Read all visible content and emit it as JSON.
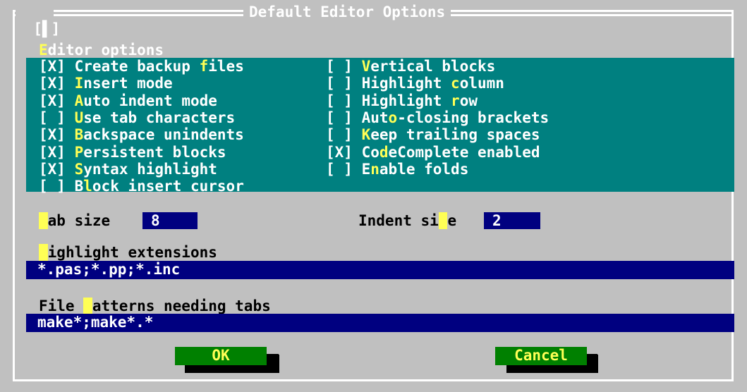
{
  "window": {
    "title": "Default Editor Options",
    "close_mark": "[▌]"
  },
  "editor_options": {
    "label": "Editor options",
    "left": [
      {
        "check": "[X]",
        "label": "Create backup files",
        "hotkey_index": 14
      },
      {
        "check": "[X]",
        "label": "Insert mode",
        "hotkey_index": 0
      },
      {
        "check": "[X]",
        "label": "Auto indent mode",
        "hotkey_index": 0
      },
      {
        "check": "[ ]",
        "label": "Use tab characters",
        "hotkey_index": 0
      },
      {
        "check": "[X]",
        "label": "Backspace unindents",
        "hotkey_index": 0
      },
      {
        "check": "[X]",
        "label": "Persistent blocks",
        "hotkey_index": 0
      },
      {
        "check": "[X]",
        "label": "Syntax highlight",
        "hotkey_index": 0
      },
      {
        "check": "[ ]",
        "label": "Block insert cursor",
        "hotkey_index": 1
      }
    ],
    "right": [
      {
        "check": "[ ]",
        "label": "Vertical blocks",
        "hotkey_index": 0
      },
      {
        "check": "[ ]",
        "label": "Highlight column",
        "hotkey_index": 10
      },
      {
        "check": "[ ]",
        "label": "Highlight row",
        "hotkey_index": 10
      },
      {
        "check": "[ ]",
        "label": "Auto-closing brackets",
        "hotkey_index": 3
      },
      {
        "check": "[ ]",
        "label": "Keep trailing spaces",
        "hotkey_index": 0
      },
      {
        "check": "[X]",
        "label": "CodeComplete enabled",
        "hotkey_index": 2
      },
      {
        "check": "[ ]",
        "label": "Enable folds",
        "hotkey_index": 1
      }
    ]
  },
  "tab_size": {
    "label": "Tab size",
    "value": "8"
  },
  "indent_size": {
    "label": "Indent size",
    "value": "2"
  },
  "highlight_extensions": {
    "label": "Highlight extensions",
    "value": "*.pas;*.pp;*.inc"
  },
  "file_patterns": {
    "label": "File patterns needing tabs",
    "value": "make*;make*.*"
  },
  "buttons": {
    "ok": "OK",
    "cancel": "Cancel"
  },
  "colors": {
    "dialog_bg": "#c0c0c0",
    "group_bg": "#008080",
    "input_bg": "#000080",
    "button_bg": "#008000",
    "hotkey": "#ffff55"
  }
}
